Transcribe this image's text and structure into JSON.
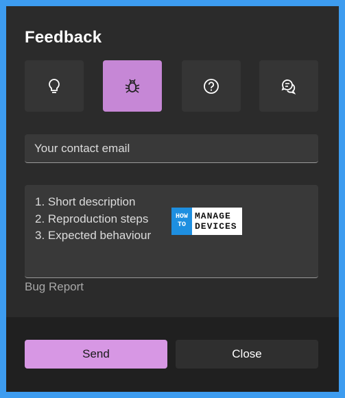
{
  "dialog": {
    "title": "Feedback",
    "types": [
      {
        "icon": "lightbulb-icon",
        "selected": false
      },
      {
        "icon": "bug-icon",
        "selected": true
      },
      {
        "icon": "question-icon",
        "selected": false
      },
      {
        "icon": "chat-icon",
        "selected": false
      }
    ],
    "email_placeholder": "Your contact email",
    "description_lines": [
      "1. Short description",
      "2. Reproduction steps",
      "3. Expected behaviour"
    ],
    "watermark": {
      "left_top": "HOW",
      "left_bottom": "TO",
      "right_top": "MANAGE",
      "right_bottom": "DEVICES"
    },
    "hint": "Bug Report",
    "send_label": "Send",
    "close_label": "Close"
  },
  "colors": {
    "accent": "#c687d6",
    "send": "#d797e4",
    "background": "#2b2b2b",
    "frame": "#3d9cf0"
  }
}
